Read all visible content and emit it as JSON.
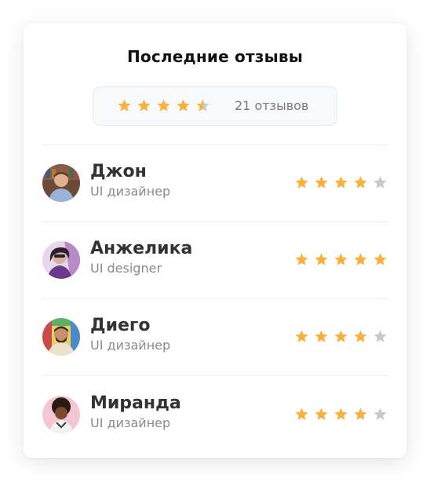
{
  "title": "Последние отзывы",
  "summary": {
    "rating": 4.5,
    "count_text": "21 отзывов"
  },
  "colors": {
    "star_filled": "#FBB03B",
    "star_empty": "#C8C8C8"
  },
  "reviews": [
    {
      "name": "Джон",
      "role": "UI дизайнер",
      "rating": 4,
      "avatar_icon": "person-photo-icon"
    },
    {
      "name": "Анжелика",
      "role": "UI designer",
      "rating": 5,
      "avatar_icon": "person-photo-icon"
    },
    {
      "name": "Диего",
      "role": "UI дизайнер",
      "rating": 4,
      "avatar_icon": "person-photo-icon"
    },
    {
      "name": "Миранда",
      "role": "UI дизайнер",
      "rating": 4,
      "avatar_icon": "person-photo-icon"
    }
  ]
}
